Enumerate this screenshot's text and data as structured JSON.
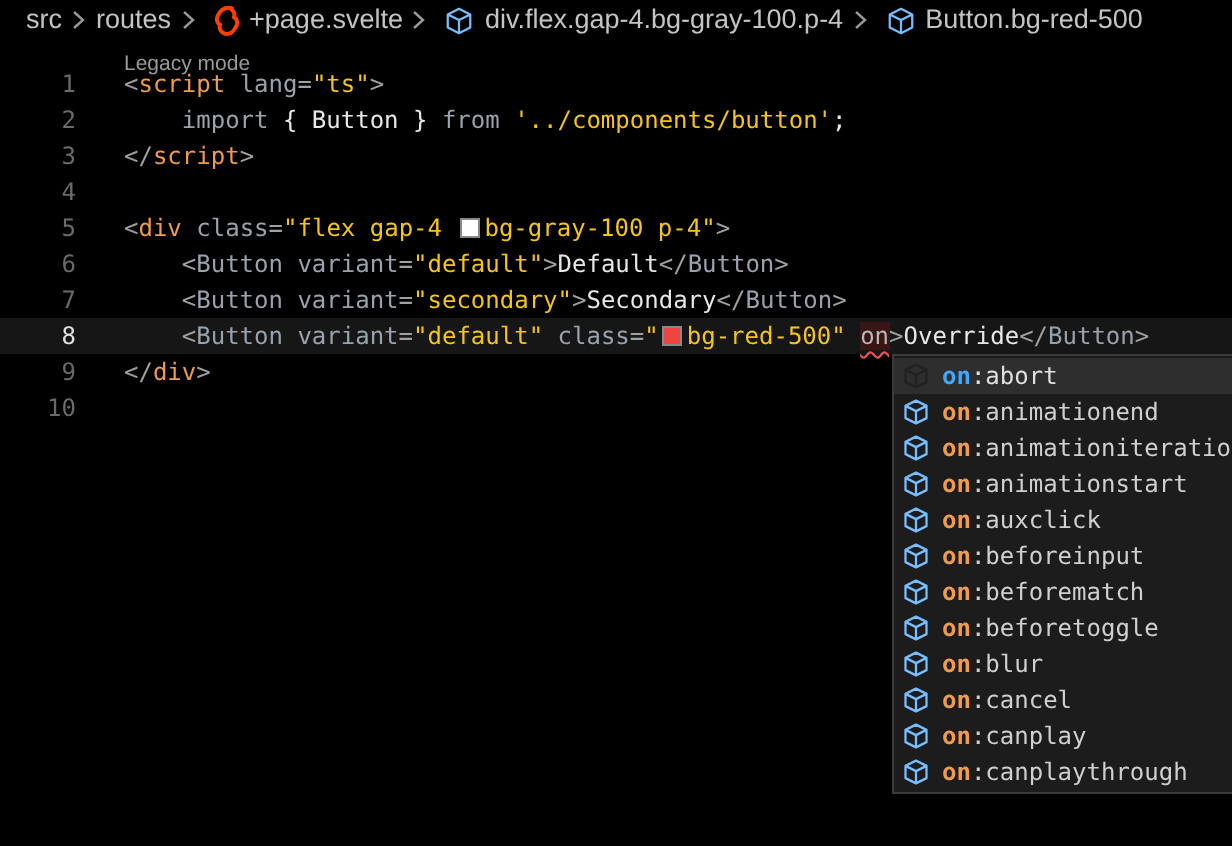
{
  "breadcrumb": [
    {
      "label": "src",
      "kind": "folder"
    },
    {
      "label": "routes",
      "kind": "folder"
    },
    {
      "label": "+page.svelte",
      "kind": "svelte"
    },
    {
      "label": "div.flex.gap-4.bg-gray-100.p-4",
      "kind": "symbol"
    },
    {
      "label": "Button.bg-red-500",
      "kind": "symbol"
    }
  ],
  "codelens": "Legacy mode",
  "lines": [
    {
      "number": "1",
      "current": false,
      "tokens": [
        {
          "kind": "punct",
          "text": "<"
        },
        {
          "kind": "tag",
          "text": "script"
        },
        {
          "kind": "attr",
          "text": " lang"
        },
        {
          "kind": "punct",
          "text": "="
        },
        {
          "kind": "string",
          "text": "\"ts\""
        },
        {
          "kind": "punct",
          "text": ">"
        }
      ]
    },
    {
      "number": "2",
      "current": false,
      "tokens": [
        {
          "kind": "attr",
          "text": "    import"
        },
        {
          "kind": "text",
          "text": " { Button } "
        },
        {
          "kind": "attr",
          "text": "from"
        },
        {
          "kind": "string",
          "text": " '../components/button'"
        },
        {
          "kind": "text",
          "text": ";"
        }
      ]
    },
    {
      "number": "3",
      "current": false,
      "tokens": [
        {
          "kind": "punct",
          "text": "</"
        },
        {
          "kind": "tag",
          "text": "script"
        },
        {
          "kind": "punct",
          "text": ">"
        }
      ]
    },
    {
      "number": "4",
      "current": false
    },
    {
      "number": "5",
      "current": false,
      "tokens": [
        {
          "kind": "punct",
          "text": "<"
        },
        {
          "kind": "tag",
          "text": "div"
        },
        {
          "kind": "attr",
          "text": " class"
        },
        {
          "kind": "punct",
          "text": "="
        },
        {
          "kind": "string",
          "text": "\"flex gap-4 "
        },
        {
          "kind": "swatch",
          "color": "#ffffff"
        },
        {
          "kind": "string",
          "text": "bg-gray-100 p-4\""
        },
        {
          "kind": "punct",
          "text": ">"
        }
      ]
    },
    {
      "number": "6",
      "current": false,
      "tokens": [
        {
          "kind": "punct",
          "text": "    <"
        },
        {
          "kind": "attr",
          "text": "Button"
        },
        {
          "kind": "attr",
          "text": " variant"
        },
        {
          "kind": "punct",
          "text": "="
        },
        {
          "kind": "string",
          "text": "\"default\""
        },
        {
          "kind": "punct",
          "text": ">"
        },
        {
          "kind": "text",
          "text": "Default"
        },
        {
          "kind": "punct",
          "text": "</"
        },
        {
          "kind": "attr",
          "text": "Button"
        },
        {
          "kind": "punct",
          "text": ">"
        }
      ]
    },
    {
      "number": "7",
      "current": false,
      "tokens": [
        {
          "kind": "punct",
          "text": "    <"
        },
        {
          "kind": "attr",
          "text": "Button"
        },
        {
          "kind": "attr",
          "text": " variant"
        },
        {
          "kind": "punct",
          "text": "="
        },
        {
          "kind": "string",
          "text": "\"secondary\""
        },
        {
          "kind": "punct",
          "text": ">"
        },
        {
          "kind": "text",
          "text": "Secondary"
        },
        {
          "kind": "punct",
          "text": "</"
        },
        {
          "kind": "attr",
          "text": "Button"
        },
        {
          "kind": "punct",
          "text": ">"
        }
      ]
    },
    {
      "number": "8",
      "current": true,
      "tokens": [
        {
          "kind": "punct",
          "text": "    <"
        },
        {
          "kind": "attr",
          "text": "Button"
        },
        {
          "kind": "attr",
          "text": " variant"
        },
        {
          "kind": "punct",
          "text": "="
        },
        {
          "kind": "string",
          "text": "\"default\""
        },
        {
          "kind": "attr",
          "text": " class"
        },
        {
          "kind": "punct",
          "text": "="
        },
        {
          "kind": "string",
          "text": "\""
        },
        {
          "kind": "swatch",
          "color": "#ef4444"
        },
        {
          "kind": "string",
          "text": "bg-red-500\" "
        },
        {
          "kind": "error",
          "text": "on"
        },
        {
          "kind": "punct",
          "text": ">"
        },
        {
          "kind": "text",
          "text": "Override"
        },
        {
          "kind": "punct",
          "text": "</"
        },
        {
          "kind": "attr",
          "text": "Button"
        },
        {
          "kind": "punct",
          "text": ">"
        }
      ]
    },
    {
      "number": "9",
      "current": false,
      "tokens": [
        {
          "kind": "punct",
          "text": "</"
        },
        {
          "kind": "tag",
          "text": "div"
        },
        {
          "kind": "punct",
          "text": ">"
        }
      ]
    },
    {
      "number": "10",
      "current": false
    }
  ],
  "suggestions": [
    {
      "match": "on",
      "rest": ":abort",
      "selected": true
    },
    {
      "match": "on",
      "rest": ":animationend",
      "selected": false
    },
    {
      "match": "on",
      "rest": ":animationiteratio",
      "selected": false
    },
    {
      "match": "on",
      "rest": ":animationstart",
      "selected": false
    },
    {
      "match": "on",
      "rest": ":auxclick",
      "selected": false
    },
    {
      "match": "on",
      "rest": ":beforeinput",
      "selected": false
    },
    {
      "match": "on",
      "rest": ":beforematch",
      "selected": false
    },
    {
      "match": "on",
      "rest": ":beforetoggle",
      "selected": false
    },
    {
      "match": "on",
      "rest": ":blur",
      "selected": false
    },
    {
      "match": "on",
      "rest": ":cancel",
      "selected": false
    },
    {
      "match": "on",
      "rest": ":canplay",
      "selected": false
    },
    {
      "match": "on",
      "rest": ":canplaythrough",
      "selected": false
    }
  ]
}
